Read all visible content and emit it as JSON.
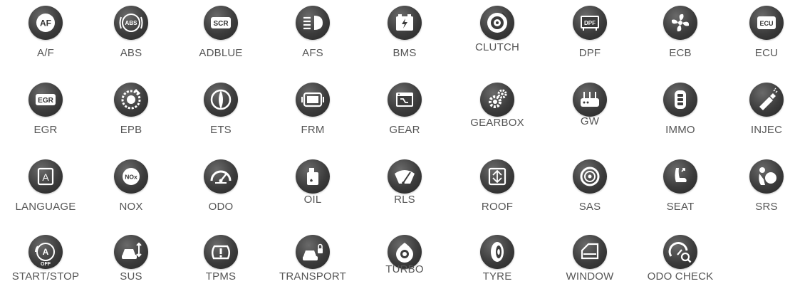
{
  "colors": {
    "icon_dark": "#3c3c3c",
    "label_text": "#555555",
    "background": "#ffffff"
  },
  "items": [
    {
      "label": "A/F",
      "icon": "af-icon"
    },
    {
      "label": "ABS",
      "icon": "abs-icon"
    },
    {
      "label": "ADBLUE",
      "icon": "scr-icon"
    },
    {
      "label": "AFS",
      "icon": "headlight-icon"
    },
    {
      "label": "BMS",
      "icon": "battery-icon"
    },
    {
      "label": "CLUTCH",
      "icon": "clutch-icon"
    },
    {
      "label": "DPF",
      "icon": "dpf-icon"
    },
    {
      "label": "ECB",
      "icon": "fan-icon"
    },
    {
      "label": "ECU",
      "icon": "ecu-icon"
    },
    {
      "label": "EGR",
      "icon": "egr-icon"
    },
    {
      "label": "EPB",
      "icon": "parking-brake-icon"
    },
    {
      "label": "ETS",
      "icon": "throttle-icon"
    },
    {
      "label": "FRM",
      "icon": "module-icon"
    },
    {
      "label": "GEAR",
      "icon": "gear-screen-icon"
    },
    {
      "label": "GEARBOX",
      "icon": "gearbox-icon"
    },
    {
      "label": "GW",
      "icon": "gateway-icon"
    },
    {
      "label": "IMMO",
      "icon": "key-fob-icon"
    },
    {
      "label": "INJEC",
      "icon": "injector-icon"
    },
    {
      "label": "LANGUAGE",
      "icon": "language-icon"
    },
    {
      "label": "NOX",
      "icon": "nox-icon"
    },
    {
      "label": "ODO",
      "icon": "speedometer-icon"
    },
    {
      "label": "OIL",
      "icon": "oil-can-icon"
    },
    {
      "label": "RLS",
      "icon": "wiper-icon"
    },
    {
      "label": "ROOF",
      "icon": "roof-icon"
    },
    {
      "label": "SAS",
      "icon": "steering-icon"
    },
    {
      "label": "SEAT",
      "icon": "seat-icon"
    },
    {
      "label": "SRS",
      "icon": "airbag-icon"
    },
    {
      "label": "START/STOP",
      "icon": "start-stop-icon",
      "badge_top": "A",
      "badge_bottom": "OFF"
    },
    {
      "label": "SUS",
      "icon": "suspension-icon"
    },
    {
      "label": "TPMS",
      "icon": "tpms-icon"
    },
    {
      "label": "TRANSPORT",
      "icon": "transport-icon"
    },
    {
      "label": "TURBO",
      "icon": "turbo-icon"
    },
    {
      "label": "TYRE",
      "icon": "tyre-icon"
    },
    {
      "label": "WINDOW",
      "icon": "window-icon"
    },
    {
      "label": "ODO CHECK",
      "icon": "odo-check-icon"
    }
  ],
  "icon_text": {
    "af": "AF",
    "abs": "ABS",
    "scr": "SCR",
    "dpf": "DPF",
    "ecu": "ECU",
    "egr": "EGR",
    "language": "A",
    "nox": "NOx"
  }
}
